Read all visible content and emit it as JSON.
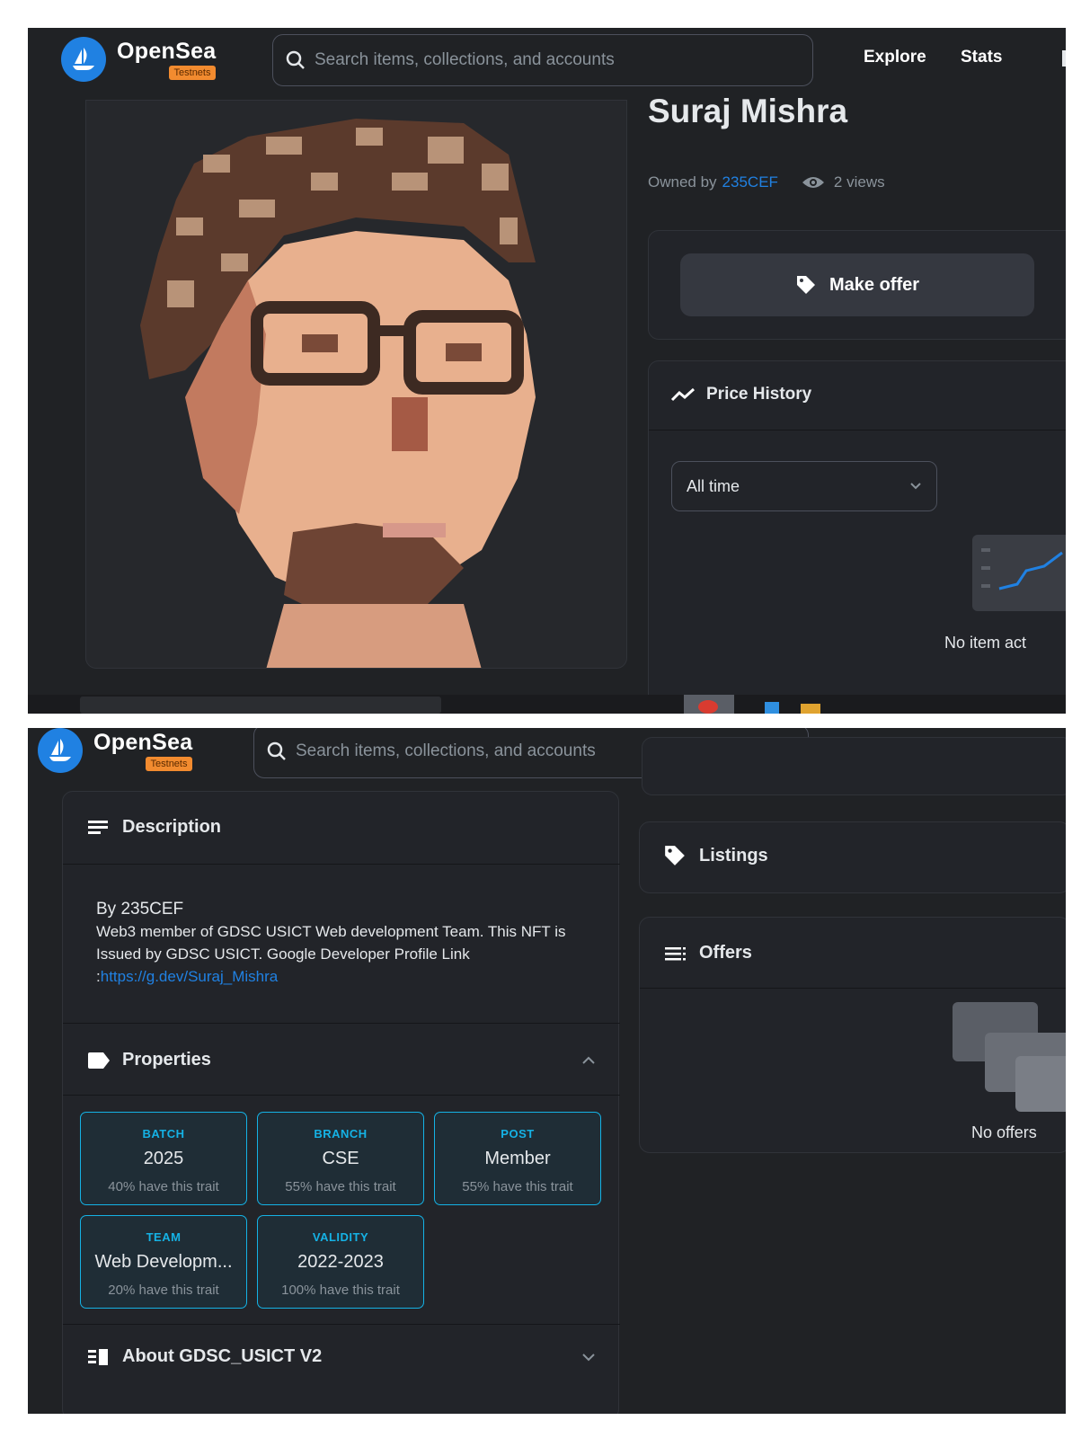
{
  "header": {
    "brand": "OpenSea",
    "badge": "Testnets",
    "search_placeholder": "Search items, collections, and accounts",
    "nav": [
      "Explore",
      "Stats"
    ]
  },
  "item": {
    "title": "Suraj Mishra",
    "owned_by_label": "Owned by",
    "owner": "235CEF",
    "views": "2 views",
    "make_offer": "Make offer"
  },
  "price_history": {
    "title": "Price History",
    "range": "All time",
    "empty": "No item act"
  },
  "description": {
    "title": "Description",
    "by": "By 235CEF",
    "text": "Web3 member of GDSC USICT Web development Team. This NFT is Issued by GDSC USICT. Google Developer Profile Link",
    "link_prefix": ":",
    "link": "https://g.dev/Suraj_Mishra"
  },
  "properties": {
    "title": "Properties",
    "items": [
      {
        "type": "BATCH",
        "value": "2025",
        "rarity": "40% have this trait"
      },
      {
        "type": "BRANCH",
        "value": "CSE",
        "rarity": "55% have this trait"
      },
      {
        "type": "POST",
        "value": "Member",
        "rarity": "55% have this trait"
      },
      {
        "type": "TEAM",
        "value": "Web Developm...",
        "rarity": "20% have this trait"
      },
      {
        "type": "VALIDITY",
        "value": "2022-2023",
        "rarity": "100% have this trait"
      }
    ]
  },
  "about": {
    "title": "About GDSC_USICT V2"
  },
  "listings": {
    "title": "Listings"
  },
  "offers": {
    "title": "Offers",
    "empty": "No offers"
  },
  "colors": {
    "accent": "#2081e2",
    "trait": "#15b2e5",
    "bg": "#202225",
    "card": "#2a2c31",
    "badge": "#f28b2f"
  }
}
